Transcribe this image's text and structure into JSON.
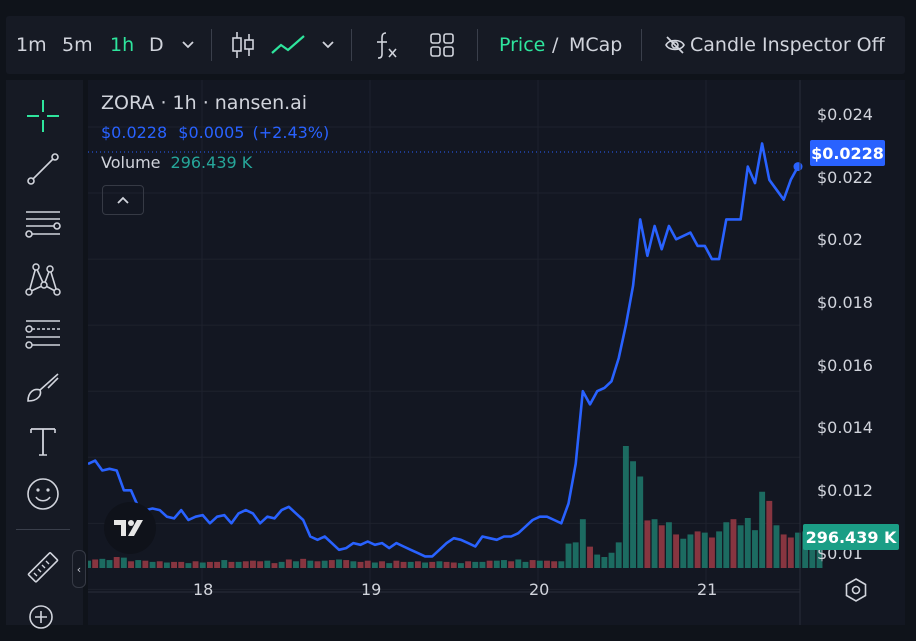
{
  "toolbar": {
    "intervals": [
      "1m",
      "5m",
      "1h",
      "D"
    ],
    "active_interval": "1h",
    "price_label": "Price",
    "slash": "/",
    "mcap_label": "MCap",
    "candle_inspector_label": "Candle Inspector Off"
  },
  "legend": {
    "title": "ZORA · 1h · nansen.ai",
    "price": "$0.0228",
    "change": "$0.0005",
    "change_pct": "(+2.43%)",
    "volume_label": "Volume",
    "volume_value": "296.439 K"
  },
  "price_scale": {
    "current_price": "$0.0228",
    "current_volume": "296.439 K",
    "ticks": [
      "$0.024",
      "$0.022",
      "$0.02",
      "$0.018",
      "$0.016",
      "$0.014",
      "$0.012",
      "$0.01"
    ]
  },
  "time_scale": {
    "ticks": [
      "18",
      "19",
      "20",
      "21"
    ]
  },
  "colors": {
    "line": "#2962ff",
    "volume_up": "#26a69a",
    "volume_down": "#ef5350",
    "active": "#2ee59d"
  },
  "chart_data": {
    "type": "line",
    "title": "ZORA · 1h · nansen.ai",
    "x_ticks": [
      "18",
      "19",
      "20",
      "21"
    ],
    "ylim": [
      0.0098,
      0.0253
    ],
    "series": [
      {
        "name": "Price",
        "values": [
          0.0138,
          0.0139,
          0.0136,
          0.01365,
          0.0136,
          0.013,
          0.013,
          0.0125,
          0.0124,
          0.01245,
          0.0124,
          0.0122,
          0.01215,
          0.0124,
          0.0121,
          0.0122,
          0.01225,
          0.012,
          0.0122,
          0.01225,
          0.012,
          0.0123,
          0.0124,
          0.0123,
          0.012,
          0.0122,
          0.01215,
          0.0124,
          0.0125,
          0.0123,
          0.0121,
          0.0116,
          0.0115,
          0.0116,
          0.0114,
          0.0112,
          0.01125,
          0.0114,
          0.01135,
          0.01145,
          0.01135,
          0.0114,
          0.01125,
          0.0114,
          0.0113,
          0.0112,
          0.0111,
          0.011,
          0.011,
          0.0112,
          0.0114,
          0.01155,
          0.0115,
          0.0114,
          0.0113,
          0.0116,
          0.01155,
          0.0115,
          0.0116,
          0.0116,
          0.0117,
          0.0119,
          0.0121,
          0.0122,
          0.0122,
          0.0121,
          0.012,
          0.0126,
          0.0138,
          0.016,
          0.0156,
          0.016,
          0.0161,
          0.0163,
          0.017,
          0.018,
          0.0192,
          0.0212,
          0.0201,
          0.021,
          0.0203,
          0.021,
          0.0206,
          0.0207,
          0.0208,
          0.0204,
          0.0204,
          0.02,
          0.02,
          0.0212,
          0.0212,
          0.0212,
          0.0228,
          0.0223,
          0.0235,
          0.0224,
          0.0221,
          0.0218,
          0.0224,
          0.0228
        ]
      },
      {
        "name": "Volume",
        "values": [
          12,
          14,
          15,
          13,
          18,
          17,
          11,
          13,
          12,
          10,
          11,
          9,
          10,
          10,
          8,
          11,
          9,
          10,
          10,
          13,
          10,
          10,
          11,
          12,
          11,
          12,
          8,
          10,
          14,
          11,
          15,
          12,
          11,
          12,
          13,
          14,
          13,
          11,
          10,
          12,
          9,
          11,
          8,
          12,
          10,
          10,
          11,
          9,
          10,
          11,
          10,
          9,
          8,
          11,
          10,
          10,
          12,
          12,
          13,
          11,
          14,
          10,
          13,
          12,
          12,
          11,
          11,
          40,
          42,
          80,
          35,
          22,
          18,
          25,
          42,
          200,
          175,
          150,
          78,
          80,
          70,
          75,
          55,
          48,
          55,
          60,
          58,
          50,
          60,
          75,
          80,
          70,
          82,
          62,
          125,
          110,
          70,
          55,
          50,
          58,
          60,
          58,
          65
        ],
        "up": [
          1,
          0,
          1,
          1,
          0,
          1,
          0,
          1,
          0,
          1,
          0,
          1,
          0,
          0,
          1,
          0,
          1,
          0,
          0,
          1,
          0,
          1,
          0,
          0,
          0,
          1,
          0,
          1,
          0,
          1,
          0,
          1,
          0,
          1,
          0,
          1,
          0,
          1,
          0,
          0,
          1,
          0,
          1,
          0,
          0,
          1,
          0,
          1,
          0,
          1,
          0,
          0,
          1,
          0,
          1,
          1,
          0,
          1,
          1,
          0,
          1,
          1,
          0,
          1,
          0,
          0,
          1,
          1,
          1,
          1,
          0,
          1,
          1,
          1,
          1,
          1,
          1,
          1,
          0,
          1,
          0,
          1,
          0,
          1,
          1,
          0,
          1,
          0,
          1,
          1,
          0,
          1,
          1,
          1,
          1,
          0,
          1,
          0,
          0,
          1,
          1,
          1,
          1
        ]
      }
    ]
  }
}
